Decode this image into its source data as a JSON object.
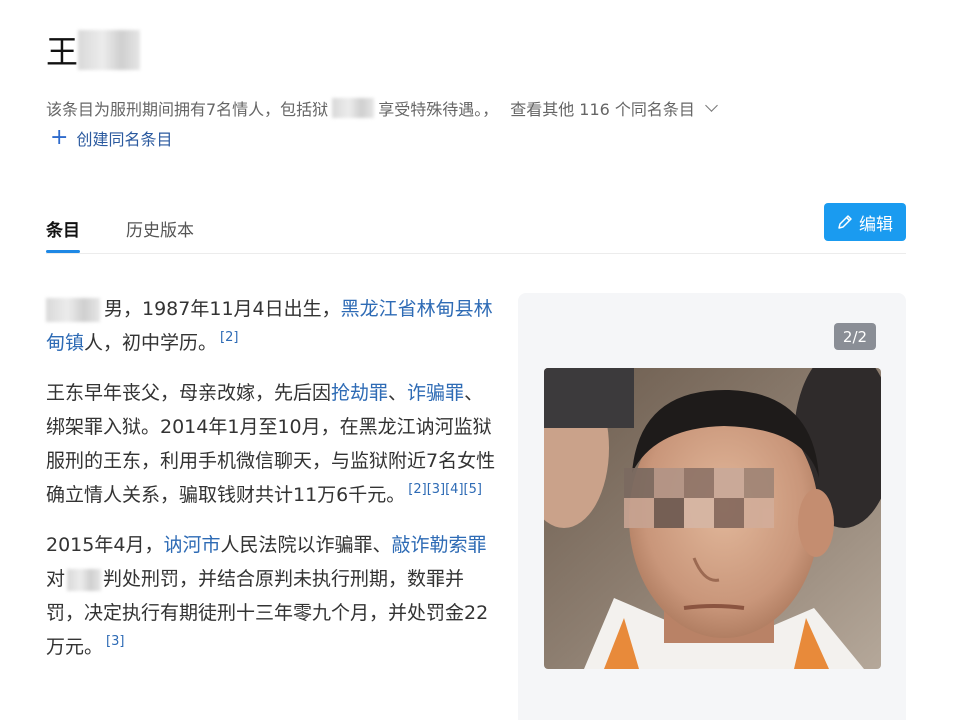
{
  "title": {
    "char": "王"
  },
  "summary": {
    "prefix": "该条目为服刑期间拥有7名情人，包括狱",
    "suffix": "享受特殊待遇。，",
    "others": "查看其他 116 个同名条目"
  },
  "create_link": {
    "plus": "+",
    "label": "创建同名条目"
  },
  "tabs": [
    {
      "label": "条目"
    },
    {
      "label": "历史版本"
    }
  ],
  "edit_button": {
    "label": "编辑",
    "icon": "pencil-icon"
  },
  "article": {
    "p1": {
      "t1": "男，1987年11月4日出生，",
      "link1": "黑龙江省林甸县林甸镇",
      "t2": "人，初中学历。",
      "ref": "[2]"
    },
    "p2": {
      "t1": "王东早年丧父，母亲改嫁，先后因",
      "link1": "抢劫罪",
      "t2": "、",
      "link2": "诈骗罪",
      "t3": "、绑架罪入狱。2014年1月至10月，在黑龙江讷河监狱服刑的王东，利用手机微信聊天，与监狱附近7名女性确立情人关系，骗取钱财共计11万6千元。",
      "refs": "[2][3][4][5]"
    },
    "p3": {
      "t1": "2015年4月，",
      "link1": "讷河市",
      "t2": "人民法院以诈骗罪、",
      "link2": "敲诈勒索罪",
      "t3": "对",
      "t4": "判处刑罚，并结合原判未执行刑期，数罪并罚，决定执行有期徒刑十三年零九个月，并处罚金22万元。",
      "ref": "[3]"
    }
  },
  "gallery": {
    "counter": "2/2"
  },
  "colors": {
    "accent": "#1a9bf0",
    "link": "#2e6bb5",
    "tab_underline": "#1e88e5"
  }
}
